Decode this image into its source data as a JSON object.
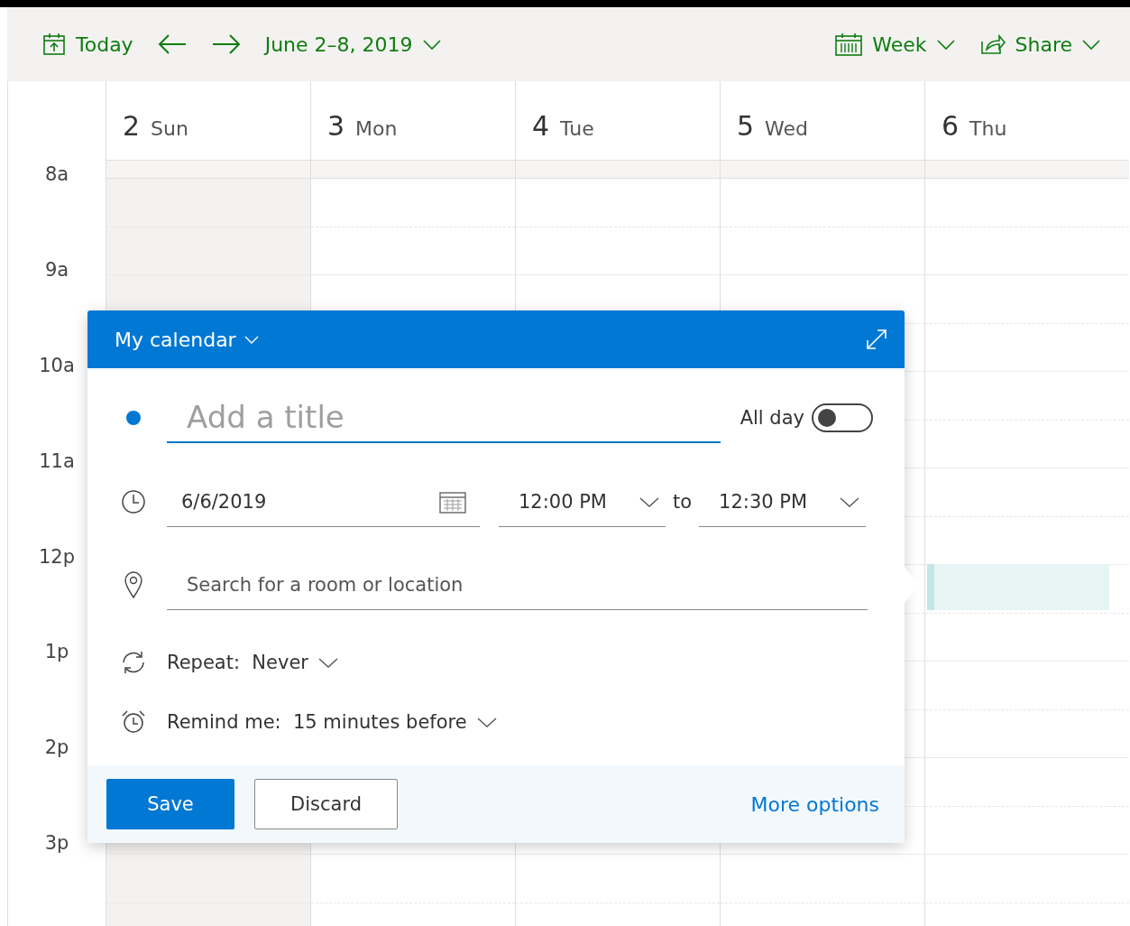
{
  "toolbar": {
    "today": "Today",
    "date_range": "June 2–8, 2019",
    "view": "Week",
    "share": "Share"
  },
  "days": [
    {
      "number": "2",
      "name": "Sun",
      "weekend": true
    },
    {
      "number": "3",
      "name": "Mon",
      "weekend": false
    },
    {
      "number": "4",
      "name": "Tue",
      "weekend": false
    },
    {
      "number": "5",
      "name": "Wed",
      "weekend": false
    },
    {
      "number": "6",
      "name": "Thu",
      "weekend": false
    }
  ],
  "hours": [
    "8a",
    "9a",
    "10a",
    "11a",
    "12p",
    "1p",
    "2p",
    "3p"
  ],
  "popup": {
    "calendar": "My calendar",
    "title_placeholder": "Add a title",
    "all_day": {
      "label": "All day",
      "on": false
    },
    "date": "6/6/2019",
    "start": "12:00 PM",
    "to": "to",
    "end": "12:30 PM",
    "location_placeholder": "Search for a room or location",
    "repeat": {
      "label": "Repeat:",
      "value": "Never"
    },
    "remind": {
      "label": "Remind me:",
      "value": "15 minutes before"
    },
    "save": "Save",
    "discard": "Discard",
    "more": "More options"
  }
}
